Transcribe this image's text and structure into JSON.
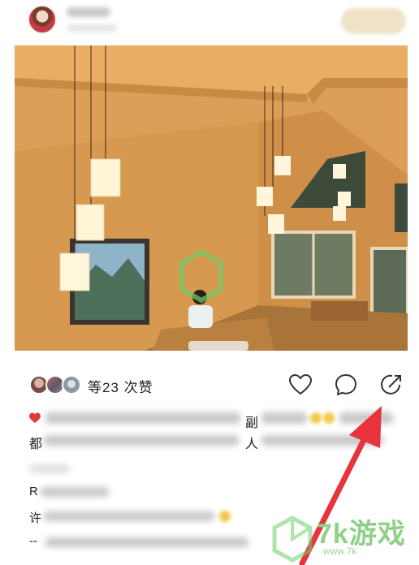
{
  "header": {
    "avatar_icon": "avatar-icon"
  },
  "post": {
    "photo_icon": "photo-interior-room"
  },
  "likes": {
    "count_label": "等23 次赞"
  },
  "actions": {
    "like_icon": "heart-icon",
    "comment_icon": "comment-icon",
    "share_icon": "share-arrow-icon"
  },
  "caption": {
    "first_char": "都",
    "mid_char_1": "副",
    "mid_char_2": "人"
  },
  "comments": {
    "user_1": "R",
    "user_2": "许",
    "user_3": "--"
  },
  "watermark": {
    "text": "7k游戏",
    "url": "www.7k"
  },
  "colors": {
    "arrow": "#e8323c",
    "watermark": "#8fd08a"
  }
}
